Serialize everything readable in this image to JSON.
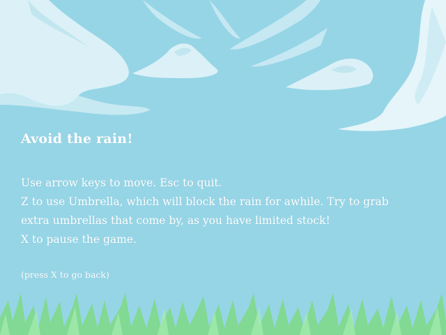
{
  "screen": {
    "sky_color": "#96d5e6",
    "cloud_color": "#e8f6fa",
    "grass_color": "#7ed98a"
  },
  "instructions": {
    "title": "Avoid the rain!",
    "lines": [
      "Use arrow keys to move.  Esc to quit.",
      "Z to use Umbrella, which will block the rain for awhile. Try to grab",
      "extra umbrellas that come by, as you have limited stock!",
      "X to pause the game."
    ],
    "back_hint": "(press X to go back)"
  }
}
